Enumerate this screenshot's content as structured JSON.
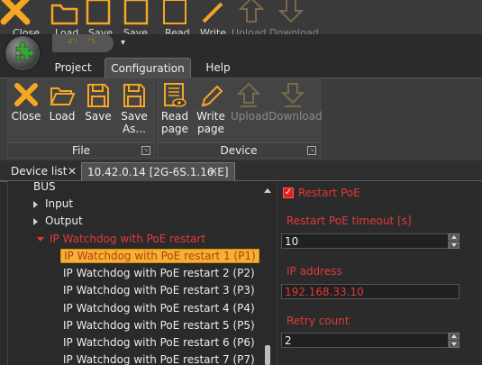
{
  "ghost_ribbon": {
    "labels": [
      "Close",
      "Load",
      "Save",
      "Save",
      "Read",
      "Write",
      "Upload",
      "Download"
    ]
  },
  "menu": {
    "tabs": [
      "Project",
      "Configuration",
      "Help"
    ],
    "active": "Configuration"
  },
  "ribbon": {
    "file_group": {
      "title": "File",
      "buttons": [
        {
          "label": "Close",
          "icon": "close-x-icon"
        },
        {
          "label": "Load",
          "icon": "folder-open-icon"
        },
        {
          "label": "Save",
          "icon": "floppy-disk-icon"
        },
        {
          "label_line1": "Save",
          "label_line2": "As...",
          "icon": "floppy-disk-icon"
        }
      ]
    },
    "device_group": {
      "title": "Device",
      "buttons": [
        {
          "label_line1": "Read",
          "label_line2": "page",
          "icon": "read-page-icon"
        },
        {
          "label_line1": "Write",
          "label_line2": "page",
          "icon": "pencil-icon"
        },
        {
          "label": "Upload",
          "icon": "upload-arrow-icon",
          "disabled": true
        },
        {
          "label": "Download",
          "icon": "download-arrow-icon",
          "disabled": true
        }
      ]
    }
  },
  "doc_tabs": {
    "device_list": "Device list",
    "close_glyph": "✕",
    "active_tab": "10.42.0.14 [2G-6S.1.16.E]"
  },
  "tree": {
    "items": [
      {
        "label": "BUS",
        "indent": 2,
        "style": "plain"
      },
      {
        "label": "Input",
        "indent": 1,
        "style": "collapsed"
      },
      {
        "label": "Output",
        "indent": 1,
        "style": "collapsed"
      },
      {
        "label": "IP Watchdog with PoE restart",
        "indent": 1,
        "style": "expanded-red"
      },
      {
        "label": "IP Watchdog with PoE restart 1 (P1)",
        "indent": 3,
        "style": "selected"
      },
      {
        "label": "IP Watchdog with PoE restart 2 (P2)",
        "indent": 3,
        "style": "plain"
      },
      {
        "label": "IP Watchdog with PoE restart 3 (P3)",
        "indent": 3,
        "style": "plain"
      },
      {
        "label": "IP Watchdog with PoE restart 4 (P4)",
        "indent": 3,
        "style": "plain"
      },
      {
        "label": "IP Watchdog with PoE restart 5 (P5)",
        "indent": 3,
        "style": "plain"
      },
      {
        "label": "IP Watchdog with PoE restart 6 (P6)",
        "indent": 3,
        "style": "plain"
      },
      {
        "label": "IP Watchdog with PoE restart 7 (P7)",
        "indent": 3,
        "style": "plain"
      }
    ]
  },
  "properties": {
    "restart_poe": {
      "label": "Restart PoE",
      "checked": true
    },
    "restart_timeout": {
      "label": "Restart PoE timeout [s]",
      "value": "10"
    },
    "ip_address": {
      "label": "IP address",
      "value": "192.168.33.10"
    },
    "retry_count": {
      "label": "Retry count",
      "value": "2"
    }
  },
  "colors": {
    "accent_orange": "#f5a623",
    "error_red": "#e03a3a",
    "selection_yellow": "#f2b233"
  }
}
